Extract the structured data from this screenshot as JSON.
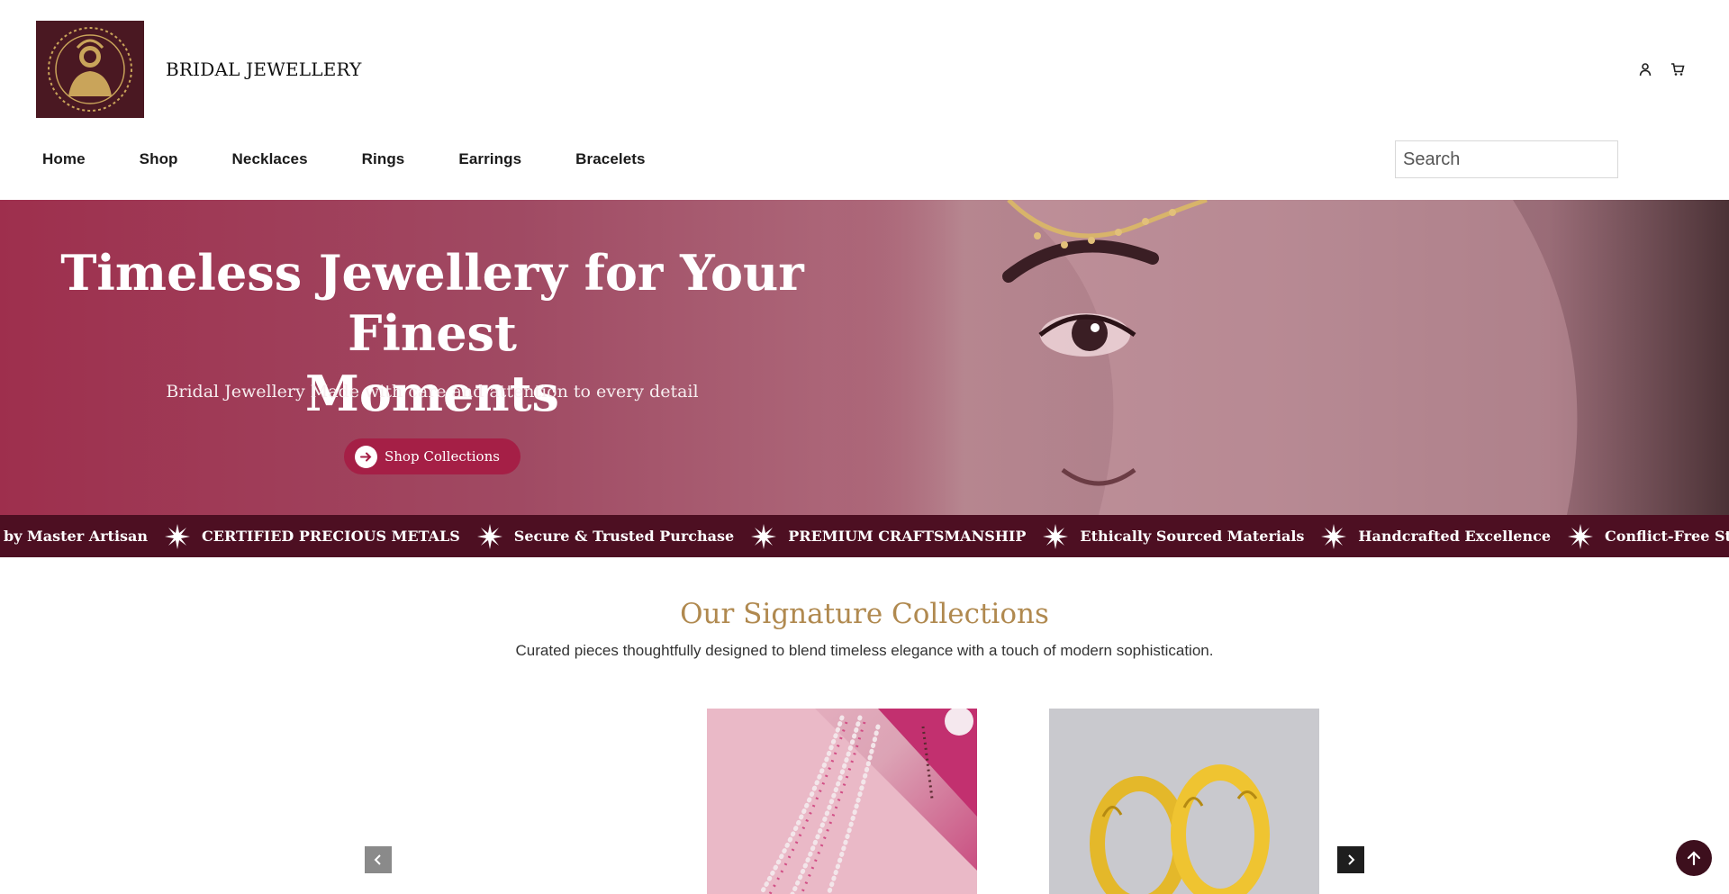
{
  "header": {
    "brand": "BRIDAL JEWELLERY",
    "logo_icon": "bride-portrait-logo",
    "account_icon": "user-icon",
    "cart_icon": "cart-icon"
  },
  "nav": {
    "items": [
      {
        "label": "Home"
      },
      {
        "label": "Shop"
      },
      {
        "label": "Necklaces"
      },
      {
        "label": "Rings"
      },
      {
        "label": "Earrings"
      },
      {
        "label": "Bracelets"
      }
    ]
  },
  "search": {
    "placeholder": "Search",
    "value": ""
  },
  "hero": {
    "title_line1": "Timeless Jewellery for Your Finest",
    "title_line2": "Moments",
    "subtitle": "Bridal Jewellery Made with care and attention to every detail",
    "cta_label": "Shop Collections"
  },
  "ticker": {
    "items": [
      "by Master Artisan",
      "CERTIFIED PRECIOUS METALS",
      "Secure & Trusted Purchase",
      "PREMIUM CRAFTSMANSHIP",
      "Ethically Sourced Materials",
      "Handcrafted Excellence",
      "Conflict-Free Stones"
    ]
  },
  "collections": {
    "title": "Our Signature Collections",
    "subtitle": "Curated pieces thoughtfully designed to blend timeless elegance with a touch of modern sophistication.",
    "cards": [
      {
        "image": "pearl-necklace-on-pink-fabric"
      },
      {
        "image": "gold-bangles-pair"
      }
    ]
  },
  "colors": {
    "brand_maroon": "#4d0f22",
    "accent_gold": "#b0894f",
    "cta": "#a51f46"
  }
}
